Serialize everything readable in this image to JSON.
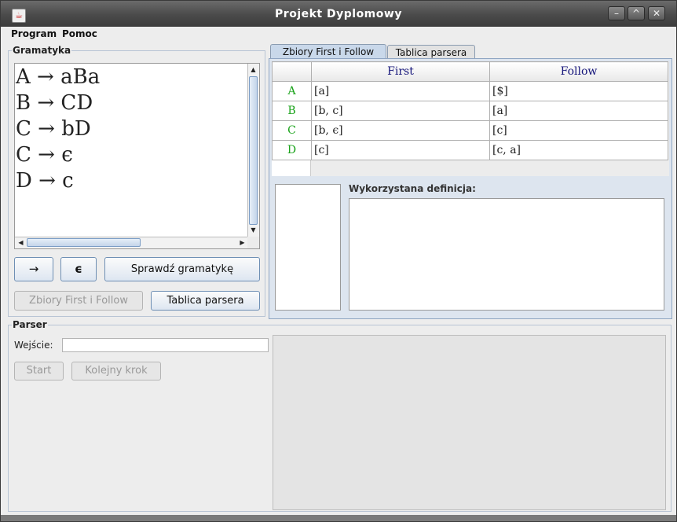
{
  "window": {
    "title": "Projekt Dyplomowy",
    "app_icon": "java-icon",
    "controls": [
      "minimize",
      "maximize",
      "close"
    ]
  },
  "menu": {
    "items": [
      "Program",
      "Pomoc"
    ]
  },
  "grammar": {
    "legend": "Gramatyka",
    "productions": [
      "A → aBa",
      "B → CD",
      "C → bD",
      "C → ϵ",
      "D → c"
    ],
    "buttons": {
      "arrow": "→",
      "epsilon": "ϵ",
      "check": "Sprawdź gramatykę",
      "first_follow": "Zbiory First i Follow",
      "parse_table": "Tablica parsera"
    }
  },
  "tabs": {
    "items": [
      "Zbiory First i Follow",
      "Tablica parsera"
    ],
    "active": 0
  },
  "first_follow_table": {
    "headers": [
      "First",
      "Follow"
    ],
    "rows": [
      {
        "nt": "A",
        "first": "[a]",
        "follow": "[$]"
      },
      {
        "nt": "B",
        "first": "[b, c]",
        "follow": "[a]"
      },
      {
        "nt": "C",
        "first": "[b, ϵ]",
        "follow": "[c]"
      },
      {
        "nt": "D",
        "first": "[c]",
        "follow": "[c, a]"
      }
    ]
  },
  "definition": {
    "label": "Wykorzystana definicja:"
  },
  "parser": {
    "legend": "Parser",
    "input_label": "Wejście:",
    "input_value": "",
    "start": "Start",
    "next_step": "Kolejny krok"
  },
  "colors": {
    "nonterminal": "#1aa31a",
    "header_text": "#14147a",
    "title_bar": "#4a4a4a",
    "tab_active": "#c9d8ea"
  }
}
